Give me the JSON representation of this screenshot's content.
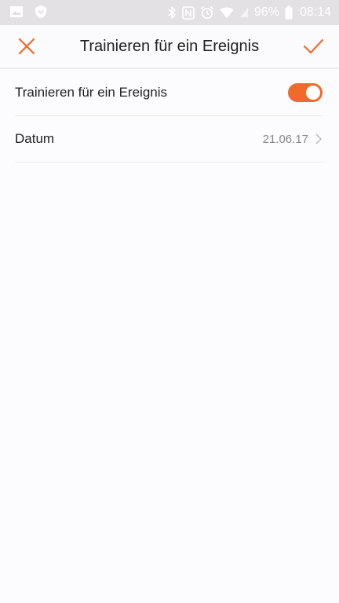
{
  "status_bar": {
    "battery": "96%",
    "time": "08:14",
    "icons": [
      "image-icon",
      "shield-icon",
      "bluetooth-icon",
      "nfc-icon",
      "alarm-icon",
      "wifi-icon",
      "signal-icon",
      "battery-icon"
    ]
  },
  "app_bar": {
    "title": "Trainieren für ein Ereignis",
    "close_icon": "close-icon",
    "confirm_icon": "check-icon"
  },
  "settings": {
    "event_toggle": {
      "label": "Trainieren für ein Ereignis",
      "on": true
    },
    "date": {
      "label": "Datum",
      "value": "21.06.17"
    }
  },
  "colors": {
    "accent": "#f06a2a",
    "status_bar_bg": "#e3e1e4",
    "background": "#fcfbfd"
  }
}
